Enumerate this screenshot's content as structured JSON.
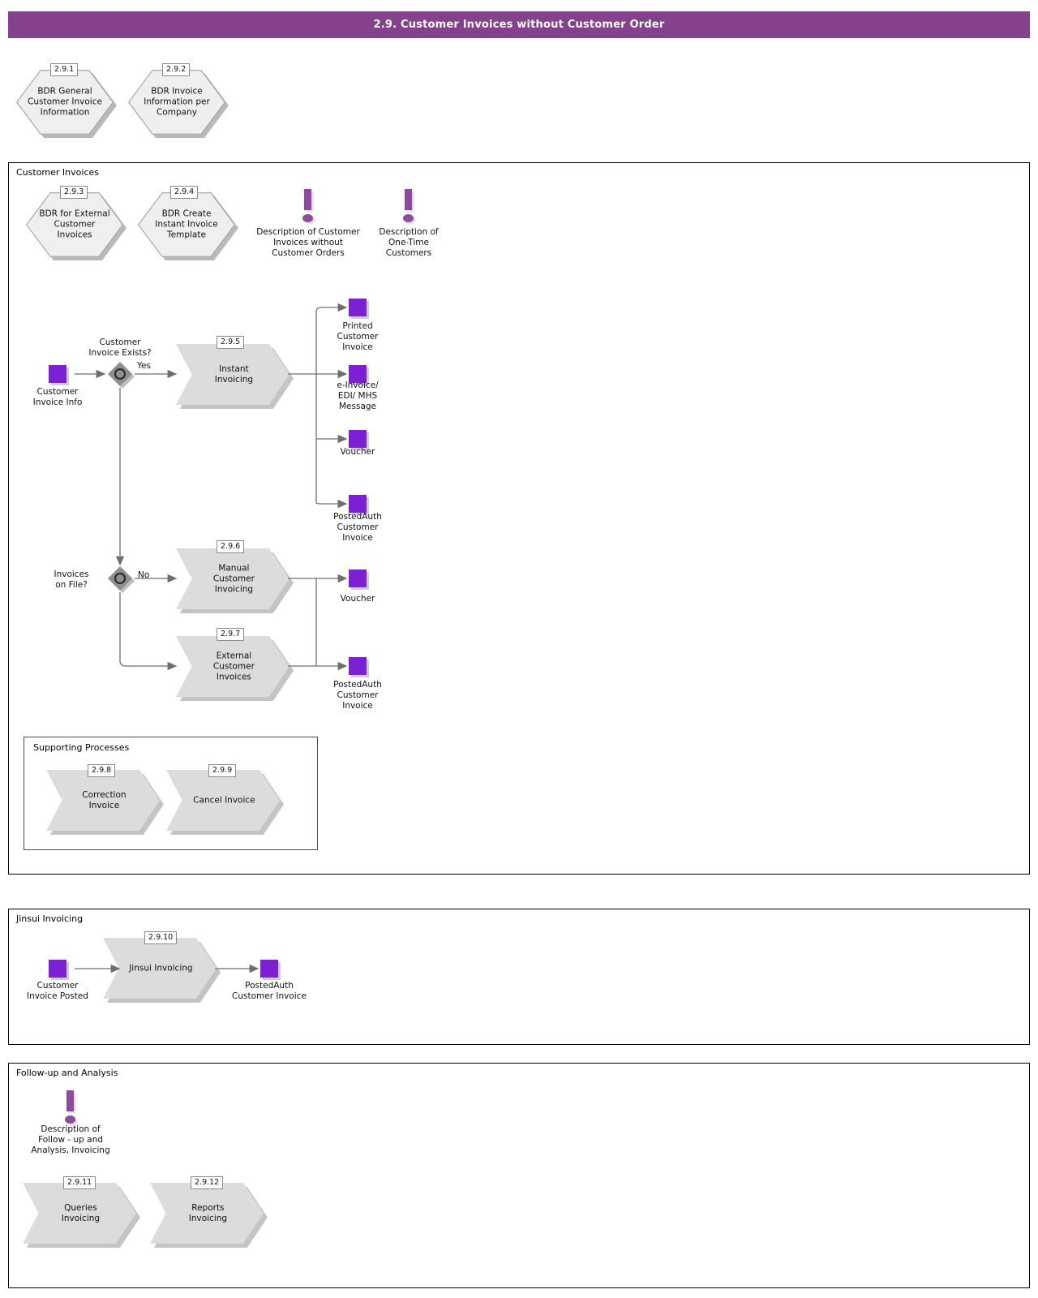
{
  "header": {
    "title": "2.9. Customer Invoices without Customer Order",
    "bar_color": "#84418C"
  },
  "colors": {
    "accent_purple": "#84418C",
    "data_object_purple": "#7B20D2",
    "note_purple": "#8E4A9E",
    "shape_fill": "#DCDCDC",
    "hex_fill": "#EFEFEF",
    "diamond_fill": "#8F8F8F",
    "connector": "#6E6E6E"
  },
  "top_level_nodes": [
    {
      "id": "2.9.1",
      "label": "BDR General\nCustomer Invoice\nInformation",
      "type": "hexagon"
    },
    {
      "id": "2.9.2",
      "label": "BDR Invoice\nInformation per\nCompany",
      "type": "hexagon"
    }
  ],
  "lanes": [
    {
      "name": "customer-invoices",
      "title": "Customer Invoices",
      "hexagons": [
        {
          "id": "2.9.3",
          "label": "BDR for External\nCustomer\nInvoices"
        },
        {
          "id": "2.9.4",
          "label": "BDR Create\nInstant Invoice\nTemplate"
        }
      ],
      "notes": [
        {
          "icon": "exclamation-icon",
          "label": "Description of Customer\nInvoices without\nCustomer Orders"
        },
        {
          "icon": "exclamation-icon",
          "label": "Description of\nOne-Time\nCustomers"
        }
      ],
      "data_objects": [
        {
          "name": "customer-invoice-info",
          "label": "Customer\nInvoice Info"
        },
        {
          "name": "printed-customer-invoice",
          "label": "Printed\nCustomer\nInvoice"
        },
        {
          "name": "e-invoice-edi-mhs-message",
          "label": "e-Invoice/\nEDI/ MHS\nMessage"
        },
        {
          "name": "voucher-instant",
          "label": "Voucher"
        },
        {
          "name": "postedauth-customer-invoice-instant",
          "label": "PostedAuth\nCustomer\nInvoice"
        },
        {
          "name": "voucher-manual",
          "label": "Voucher"
        },
        {
          "name": "postedauth-customer-invoice-external",
          "label": "PostedAuth\nCustomer\nInvoice"
        }
      ],
      "decisions": [
        {
          "name": "customer-invoice-exists",
          "label": "Customer\nInvoice Exists?",
          "edge_label": "Yes"
        },
        {
          "name": "invoices-on-file",
          "label": "Invoices\non File?",
          "edge_label": "No"
        }
      ],
      "processes": [
        {
          "id": "2.9.5",
          "label": "Instant\nInvoicing"
        },
        {
          "id": "2.9.6",
          "label": "Manual\nCustomer\nInvoicing"
        },
        {
          "id": "2.9.7",
          "label": "External\nCustomer\nInvoices"
        }
      ],
      "subbox": {
        "title": "Supporting Processes",
        "processes": [
          {
            "id": "2.9.8",
            "label": "Correction\nInvoice"
          },
          {
            "id": "2.9.9",
            "label": "Cancel Invoice"
          }
        ]
      }
    },
    {
      "name": "jinsui-invoicing",
      "title": "Jinsui Invoicing",
      "data_objects": [
        {
          "name": "customer-invoice-posted",
          "label": "Customer\nInvoice Posted"
        },
        {
          "name": "postedauth-customer-invoice-jinsui",
          "label": "PostedAuth\nCustomer Invoice"
        }
      ],
      "processes": [
        {
          "id": "2.9.10",
          "label": "Jinsui Invoicing"
        }
      ]
    },
    {
      "name": "follow-up-and-analysis",
      "title": "Follow-up and Analysis",
      "notes": [
        {
          "icon": "exclamation-icon",
          "label": "Description of\nFollow - up and\nAnalysis, Invoicing"
        }
      ],
      "processes": [
        {
          "id": "2.9.11",
          "label": "Queries\nInvoicing"
        },
        {
          "id": "2.9.12",
          "label": "Reports\nInvoicing"
        }
      ]
    }
  ]
}
